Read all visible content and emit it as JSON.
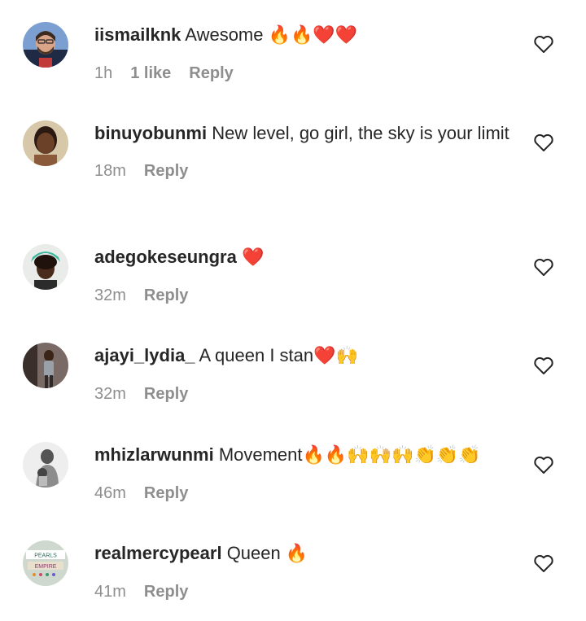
{
  "comments": [
    {
      "username": "iismailknk",
      "text": "Awesome",
      "emoji": "🔥🔥❤️❤️",
      "time": "1h",
      "likes": "1 like",
      "reply": "Reply",
      "avatar_icon": "user-avatar-man-beard-icon"
    },
    {
      "username": "binuyobunmi",
      "text": "New level, go girl, the sky is your limit",
      "emoji": "",
      "time": "18m",
      "reply": "Reply",
      "avatar_icon": "user-avatar-woman-icon"
    },
    {
      "username": "adegokeseungra",
      "text": "",
      "emoji": "❤️",
      "time": "32m",
      "reply": "Reply",
      "avatar_icon": "user-avatar-woman-icon"
    },
    {
      "username": "ajayi_lydia_",
      "text": "A queen I stan",
      "emoji": "❤️🙌",
      "time": "32m",
      "reply": "Reply",
      "avatar_icon": "user-avatar-woman-standing-icon"
    },
    {
      "username": "mhizlarwunmi",
      "text": "Movement",
      "emoji": "🔥🔥🙌🙌🙌👏👏👏",
      "time": "46m",
      "reply": "Reply",
      "avatar_icon": "user-avatar-mother-child-icon"
    },
    {
      "username": "realmercypearl",
      "text": "Queen",
      "emoji": "🔥",
      "time": "41m",
      "reply": "Reply",
      "avatar_icon": "user-avatar-pearls-empire-logo-icon",
      "avatar_text_line1": "PEARLS",
      "avatar_text_line2": "EMPIRE"
    }
  ],
  "colors": {
    "text": "#262626",
    "secondary": "#8e8e8e",
    "fire": "#f7712a",
    "heart": "#e3213b"
  }
}
